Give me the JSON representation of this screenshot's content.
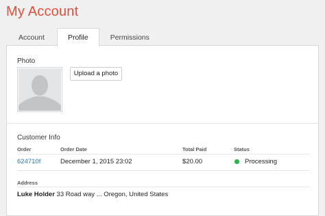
{
  "header": {
    "title": "My Account"
  },
  "tabs": [
    {
      "label": "Account"
    },
    {
      "label": "Profile"
    },
    {
      "label": "Permissions"
    }
  ],
  "photo": {
    "label": "Photo",
    "upload_label": "Upload a photo"
  },
  "customer": {
    "section_label": "Customer Info",
    "columns": [
      "Order",
      "Order Date",
      "Total Paid",
      "Status"
    ],
    "order": {
      "id": "624710f",
      "date": "December 1, 2015 23:02",
      "total": "$20.00",
      "status": "Processing",
      "status_color": "#2fb34a"
    },
    "address_label": "Address",
    "address_name": "Luke Holder",
    "address_text": "33 Road way ... Oregon, United States"
  },
  "colors": {
    "accent": "#e2503a",
    "link": "#2a7ab8",
    "status_processing": "#2fb34a"
  }
}
